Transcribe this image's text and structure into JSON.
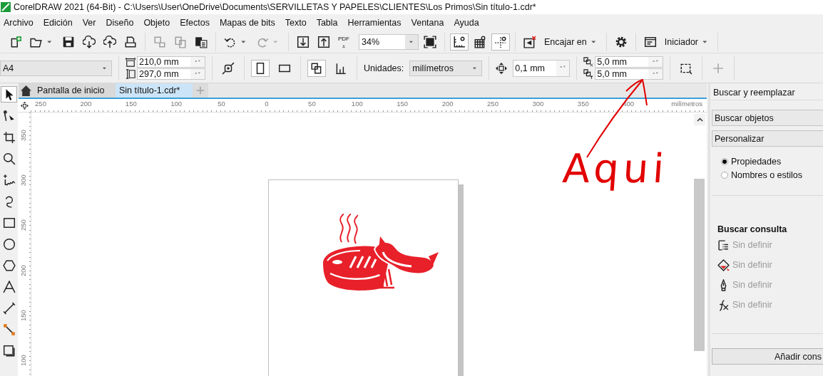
{
  "window": {
    "title": "CorelDRAW 2021 (64-Bit) - C:\\Users\\User\\OneDrive\\Documents\\SERVILLETAS Y PAPELES\\CLIENTES\\Los Primos\\Sin título-1.cdr*"
  },
  "menu": [
    "Archivo",
    "Edición",
    "Ver",
    "Diseño",
    "Objeto",
    "Efectos",
    "Mapas de bits",
    "Texto",
    "Tabla",
    "Herramientas",
    "Ventana",
    "Ayuda"
  ],
  "toolbar": [
    [
      {
        "kind": "new",
        "disabled": false
      },
      {
        "kind": "open",
        "disabled": false
      },
      {
        "kind": "save",
        "disabled": false
      },
      {
        "kind": "download",
        "disabled": false
      },
      {
        "kind": "upload",
        "disabled": false
      },
      {
        "kind": "print",
        "disabled": false
      }
    ],
    [
      {
        "kind": "copyprops",
        "disabled": true
      },
      {
        "kind": "copystyle",
        "disabled": true
      },
      {
        "kind": "paste",
        "disabled": false
      }
    ],
    [
      {
        "kind": "undo",
        "disabled": false
      },
      {
        "kind": "redo",
        "disabled": true
      }
    ],
    [
      {
        "kind": "import",
        "disabled": false
      },
      {
        "kind": "export",
        "disabled": false
      },
      {
        "kind": "pdf",
        "label": "PDF",
        "disabled": false
      },
      {
        "kind": "combo",
        "value": "34%"
      },
      {
        "kind": "fullscreen",
        "disabled": false
      }
    ],
    [
      {
        "kind": "rulers",
        "disabled": false,
        "selected": true
      },
      {
        "kind": "grid",
        "disabled": false,
        "selected": false
      },
      {
        "kind": "guides",
        "disabled": false,
        "selected": true
      }
    ],
    [
      {
        "kind": "snapoff",
        "disabled": false
      },
      {
        "kind": "menu",
        "label": "Encajar en",
        "disabled": false
      }
    ],
    [
      {
        "kind": "gear",
        "disabled": false
      }
    ],
    [
      {
        "kind": "welcome",
        "disabled": false
      },
      {
        "kind": "menu",
        "label": "Iniciador",
        "disabled": false
      }
    ]
  ],
  "property_bar": [
    [
      {
        "kind": "combo",
        "value": "A4"
      }
    ],
    [
      {
        "kind": "size",
        "width": "210,0 mm",
        "height": "297,0 mm"
      }
    ],
    [
      {
        "kind": "bleed"
      }
    ],
    [
      {
        "kind": "portrait",
        "selected": true
      },
      {
        "kind": "landscape",
        "selected": false
      }
    ],
    [
      {
        "kind": "allpages",
        "selected": true
      },
      {
        "kind": "currentpage",
        "selected": false
      }
    ],
    [
      {
        "kind": "label",
        "text": "Unidades:"
      },
      {
        "kind": "combo",
        "value": "milímetros"
      }
    ],
    [
      {
        "kind": "nudge",
        "value": "0,1 mm"
      }
    ],
    [
      {
        "kind": "duplicate",
        "x": "5,0 mm",
        "y": "5,0 mm"
      }
    ],
    [
      {
        "kind": "bbox"
      }
    ],
    [
      {
        "kind": "add"
      }
    ]
  ],
  "toolbox": [
    {
      "kind": "pick",
      "selected": true
    },
    {
      "kind": "shape",
      "selected": false
    },
    {
      "kind": "crop",
      "selected": false
    },
    {
      "kind": "zoom",
      "selected": false
    },
    {
      "kind": "freehand",
      "selected": false
    },
    {
      "kind": "curve",
      "selected": false
    },
    {
      "kind": "rectangle",
      "selected": false
    },
    {
      "kind": "ellipse",
      "selected": false
    },
    {
      "kind": "polygon",
      "selected": false
    },
    {
      "kind": "text",
      "selected": false
    },
    {
      "kind": "dimension",
      "selected": false
    },
    {
      "kind": "connector",
      "selected": false
    },
    {
      "kind": "shadow",
      "selected": false
    }
  ],
  "tabs": [
    {
      "label": "Pantalla de inicio",
      "kind": "home",
      "selected": false
    },
    {
      "label": "Sin título-1.cdr*",
      "kind": "document",
      "selected": true
    }
  ],
  "ruler": {
    "h_labels": [
      "250",
      "200",
      "150",
      "100",
      "50",
      "0",
      "50",
      "100",
      "150",
      "200",
      "250",
      "300",
      "350",
      "400"
    ],
    "unit": "milímetros",
    "v_labels": [
      "350",
      "300",
      "250",
      "200",
      "150",
      "100"
    ]
  },
  "annotation": {
    "text": "Aqui"
  },
  "docker": {
    "title": "Buscar y reemplazar",
    "dropdowns": [
      "Buscar objetos",
      "Personalizar"
    ],
    "radios": [
      {
        "label": "Propiedades",
        "selected": true
      },
      {
        "label": "Nombres o estilos",
        "selected": false
      }
    ],
    "query_title": "Buscar consulta",
    "query_rows": [
      {
        "kind": "outline",
        "label": "Sin definir",
        "disabled": true
      },
      {
        "kind": "fill",
        "label": "Sin definir",
        "disabled": true
      },
      {
        "kind": "pen",
        "label": "Sin definir",
        "disabled": true
      },
      {
        "kind": "effect",
        "label": "Sin definir",
        "disabled": true
      }
    ],
    "add_button": "Añadir cons"
  }
}
